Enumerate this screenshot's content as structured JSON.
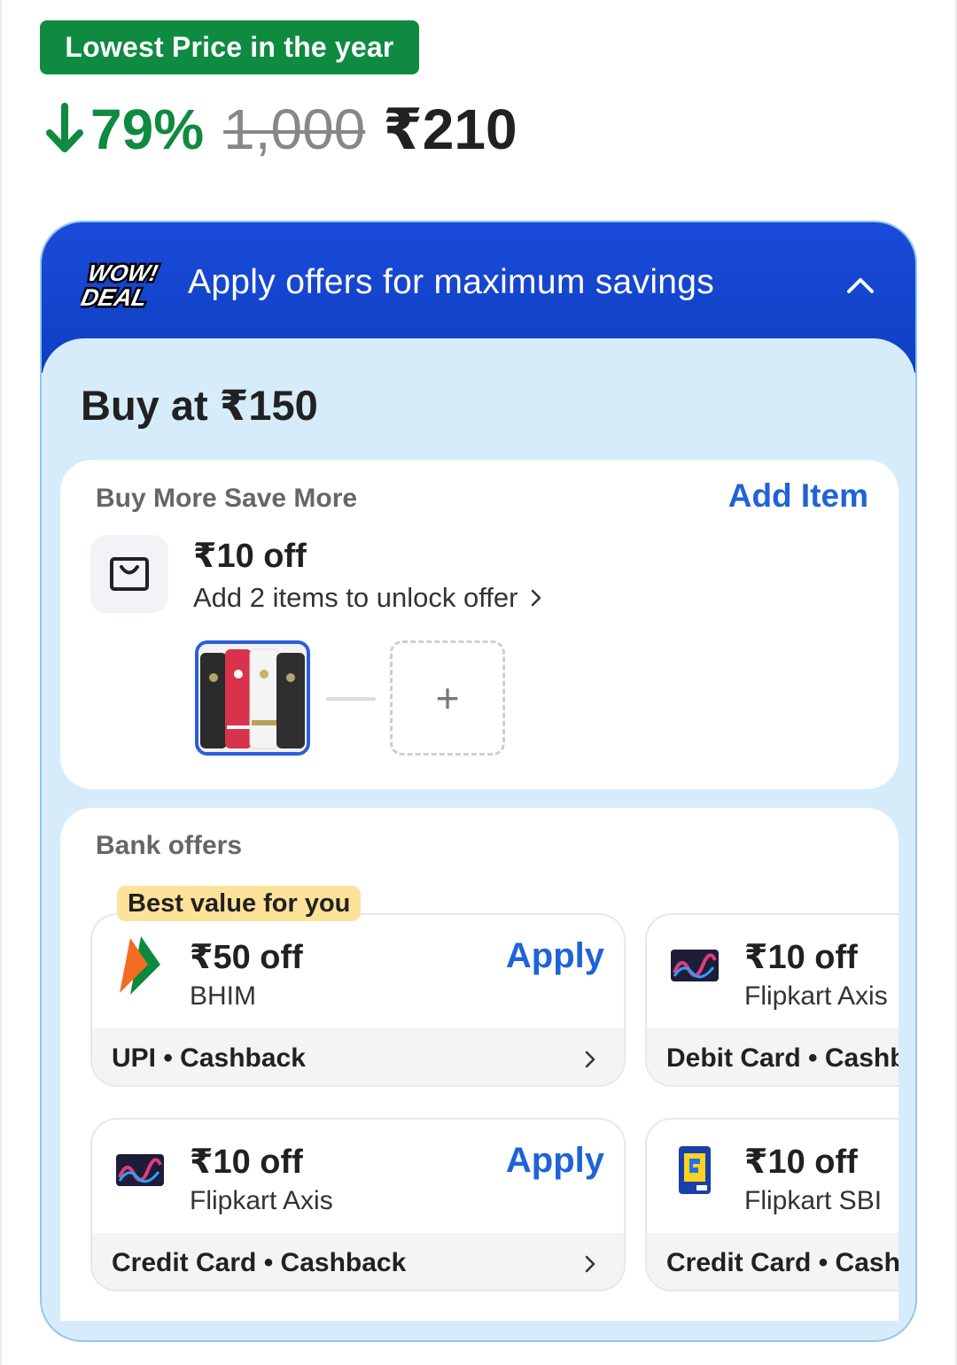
{
  "badge": {
    "lowest_price": "Lowest Price in the year"
  },
  "pricing": {
    "discount": "79%",
    "mrp": "1,000",
    "price": "₹210"
  },
  "offers": {
    "logo_line1": "WOW!",
    "logo_line2": "DEAL",
    "header_title": "Apply offers for maximum savings",
    "buy_at": "Buy at ₹150",
    "bmsm": {
      "title": "Buy More Save More",
      "add_item": "Add Item",
      "offer": "₹10 off",
      "subtitle": "Add 2 items to unlock offer",
      "add_slot": "+"
    },
    "bank": {
      "title": "Bank offers",
      "best_value": "Best value for you",
      "tiles": [
        {
          "amount": "₹50 off",
          "bank": "BHIM",
          "apply": "Apply",
          "type": "UPI • Cashback",
          "logo": "bhim-logo"
        },
        {
          "amount": "₹10 off",
          "bank": "Flipkart Axis",
          "apply": "",
          "type": "Debit Card • Cashback",
          "logo": "axis-card-logo"
        },
        {
          "amount": "₹10 off",
          "bank": "Flipkart Axis",
          "apply": "Apply",
          "type": "Credit Card • Cashback",
          "logo": "axis-card-logo"
        },
        {
          "amount": "₹10 off",
          "bank": "Flipkart SBI",
          "apply": "",
          "type": "Credit Card • Cashback",
          "logo": "sbi-card-logo"
        }
      ]
    }
  },
  "colors": {
    "green": "#0f8a41",
    "header_blue": "#1a4bd9",
    "link_blue": "#1e63d8",
    "panel_bg": "#d7ecfa",
    "badge_yellow": "#fde29a"
  }
}
